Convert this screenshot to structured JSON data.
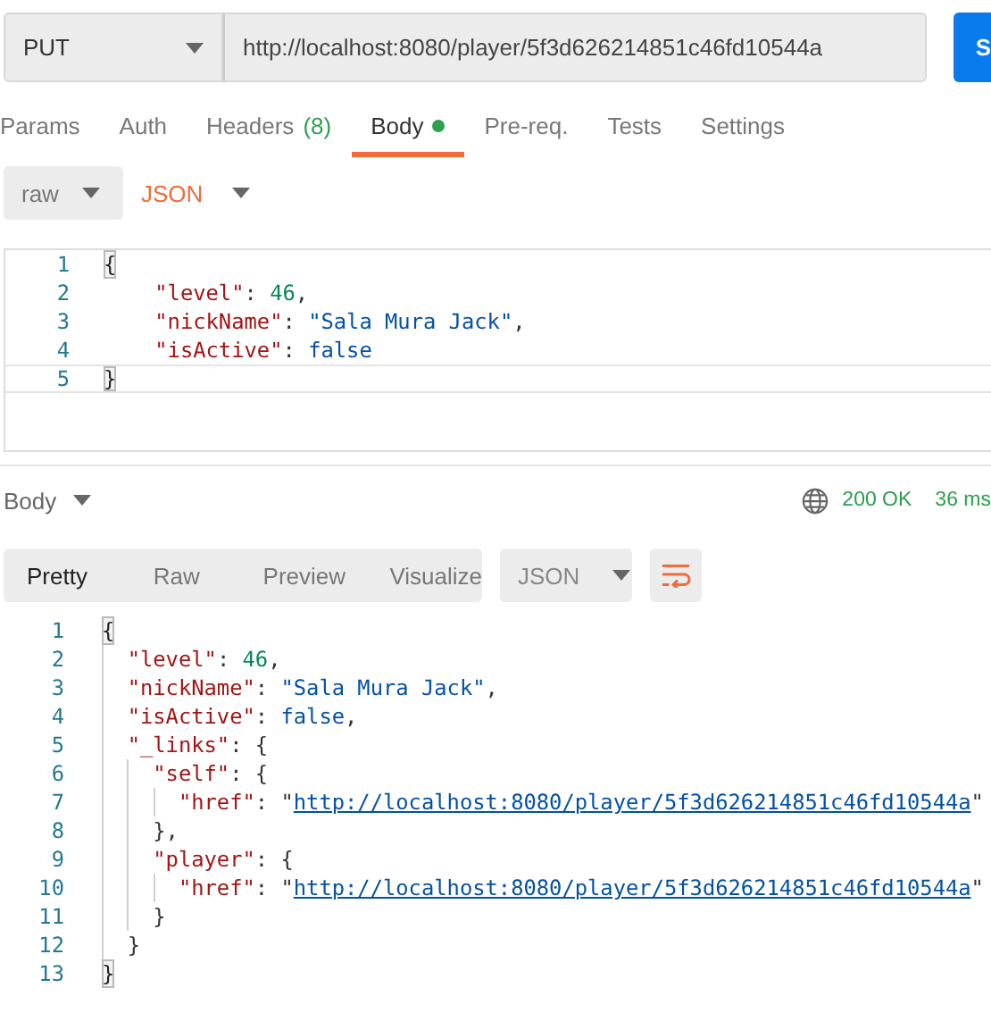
{
  "request": {
    "method": "PUT",
    "url": "http://localhost:8080/player/5f3d626214851c46fd10544a",
    "send_label": "S"
  },
  "tabs": [
    {
      "label": "Params",
      "selected": false,
      "has_content": false
    },
    {
      "label": "Auth",
      "selected": false,
      "has_content": false
    },
    {
      "label": "Headers",
      "count": "(8)",
      "selected": false,
      "has_content": false
    },
    {
      "label": "Body",
      "selected": true,
      "has_content": true
    },
    {
      "label": "Pre-req.",
      "selected": false,
      "has_content": false
    },
    {
      "label": "Tests",
      "selected": false,
      "has_content": false
    },
    {
      "label": "Settings",
      "selected": false,
      "has_content": false
    }
  ],
  "body_type": {
    "mode": "raw",
    "language": "JSON"
  },
  "request_editor": {
    "lines": [
      {
        "number": "1",
        "current": false,
        "tokens": [
          {
            "kind": "bracket",
            "text": "{"
          }
        ]
      },
      {
        "number": "2",
        "current": false,
        "tokens": [
          {
            "kind": "key",
            "text": "    \"level\""
          },
          {
            "kind": "punct",
            "text": ": "
          },
          {
            "kind": "number",
            "text": "46"
          },
          {
            "kind": "punct",
            "text": ","
          }
        ]
      },
      {
        "number": "3",
        "current": false,
        "tokens": [
          {
            "kind": "key",
            "text": "    \"nickName\""
          },
          {
            "kind": "punct",
            "text": ": "
          },
          {
            "kind": "string",
            "text": "\"Sala Mura Jack\""
          },
          {
            "kind": "punct",
            "text": ","
          }
        ]
      },
      {
        "number": "4",
        "current": false,
        "tokens": [
          {
            "kind": "key",
            "text": "    \"isActive\""
          },
          {
            "kind": "punct",
            "text": ": "
          },
          {
            "kind": "keyword",
            "text": "false"
          }
        ]
      },
      {
        "number": "5",
        "current": true,
        "tokens": [
          {
            "kind": "bracket",
            "text": "}"
          }
        ]
      }
    ]
  },
  "response": {
    "section": "Body",
    "status": "200 OK",
    "time": "36 ms",
    "view_tabs": [
      {
        "label": "Pretty",
        "selected": true
      },
      {
        "label": "Raw",
        "selected": false
      },
      {
        "label": "Preview",
        "selected": false
      },
      {
        "label": "Visualize",
        "selected": false
      }
    ],
    "format": "JSON",
    "wrap_lines": true,
    "lines": [
      {
        "number": "1",
        "tokens": [
          {
            "kind": "bracket",
            "text": "{"
          }
        ]
      },
      {
        "number": "2",
        "tokens": [
          {
            "kind": "key",
            "text": "  \"level\""
          },
          {
            "kind": "punct",
            "text": ": "
          },
          {
            "kind": "number",
            "text": "46"
          },
          {
            "kind": "punct",
            "text": ","
          }
        ]
      },
      {
        "number": "3",
        "tokens": [
          {
            "kind": "key",
            "text": "  \"nickName\""
          },
          {
            "kind": "punct",
            "text": ": "
          },
          {
            "kind": "string",
            "text": "\"Sala Mura Jack\""
          },
          {
            "kind": "punct",
            "text": ","
          }
        ]
      },
      {
        "number": "4",
        "tokens": [
          {
            "kind": "key",
            "text": "  \"isActive\""
          },
          {
            "kind": "punct",
            "text": ": "
          },
          {
            "kind": "keyword",
            "text": "false"
          },
          {
            "kind": "punct",
            "text": ","
          }
        ]
      },
      {
        "number": "5",
        "tokens": [
          {
            "kind": "key",
            "text": "  \"_links\""
          },
          {
            "kind": "punct",
            "text": ": {"
          }
        ]
      },
      {
        "number": "6",
        "tokens": [
          {
            "kind": "key",
            "text": "    \"self\""
          },
          {
            "kind": "punct",
            "text": ": {"
          }
        ]
      },
      {
        "number": "7",
        "tokens": [
          {
            "kind": "key",
            "text": "      \"href\""
          },
          {
            "kind": "punct",
            "text": ": \""
          },
          {
            "kind": "link",
            "text": "http://localhost:8080/player/5f3d626214851c46fd10544a"
          },
          {
            "kind": "punct",
            "text": "\""
          }
        ]
      },
      {
        "number": "8",
        "tokens": [
          {
            "kind": "punct",
            "text": "    },"
          }
        ]
      },
      {
        "number": "9",
        "tokens": [
          {
            "kind": "key",
            "text": "    \"player\""
          },
          {
            "kind": "punct",
            "text": ": {"
          }
        ]
      },
      {
        "number": "10",
        "tokens": [
          {
            "kind": "key",
            "text": "      \"href\""
          },
          {
            "kind": "punct",
            "text": ": \""
          },
          {
            "kind": "link",
            "text": "http://localhost:8080/player/5f3d626214851c46fd10544a"
          },
          {
            "kind": "punct",
            "text": "\""
          }
        ]
      },
      {
        "number": "11",
        "tokens": [
          {
            "kind": "punct",
            "text": "    }"
          }
        ]
      },
      {
        "number": "12",
        "tokens": [
          {
            "kind": "punct",
            "text": "  }"
          }
        ]
      },
      {
        "number": "13",
        "tokens": [
          {
            "kind": "bracket",
            "text": "}"
          }
        ]
      }
    ]
  }
}
